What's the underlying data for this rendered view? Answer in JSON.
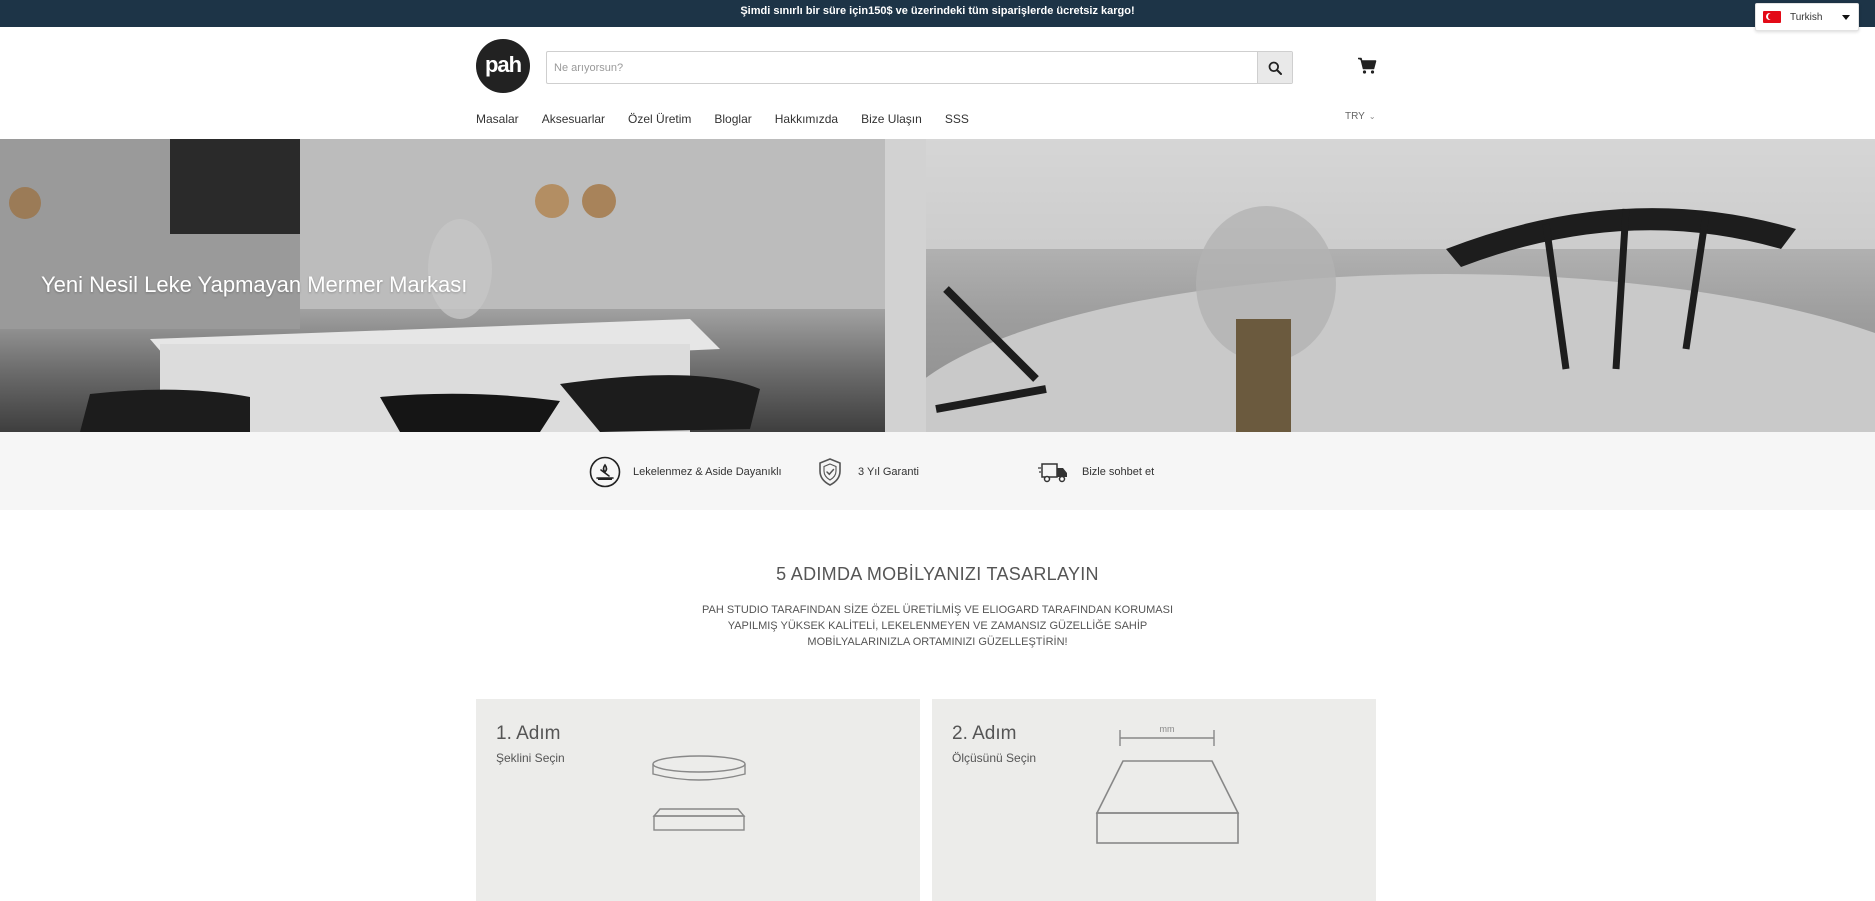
{
  "announcement": "Şimdi sınırlı bir süre için150$ ve üzerindeki tüm siparişlerde ücretsiz kargo!",
  "language_selector": {
    "label": "Turkish",
    "flag_icon": "turkey-flag-icon"
  },
  "logo": {
    "text": "pah"
  },
  "search": {
    "placeholder": "Ne arıyorsun?",
    "value": ""
  },
  "nav": {
    "items": [
      "Masalar",
      "Aksesuarlar",
      "Özel Üretim",
      "Bloglar",
      "Hakkımızda",
      "Bize Ulaşın",
      "SSS"
    ]
  },
  "currency": {
    "value": "TRY"
  },
  "hero": {
    "headline": "Yeni Nesil Leke Yapmayan Mermer Markası"
  },
  "features": [
    {
      "label": "Lekelenmez & Aside Dayanıklı",
      "icon": "stain-resistant-icon"
    },
    {
      "label": "3 Yıl Garanti",
      "icon": "shield-check-icon"
    },
    {
      "label": "Bizle sohbet et",
      "icon": "delivery-truck-icon"
    }
  ],
  "section": {
    "title": "5 ADIMDA MOBİLYANIZI TASARLAYIN",
    "description": "PAH STUDIO TARAFINDAN SİZE ÖZEL ÜRETİLMİŞ VE ELIOGARD TARAFINDAN KORUMASI YAPILMIŞ YÜKSEK KALİTELİ, LEKELENMEYEN VE ZAMANSIZ GÜZELLİĞE SAHİP MOBİLYALARINIZLA ORTAMINIZI GÜZELLEŞTİRİN!"
  },
  "steps": [
    {
      "number": "1. Adım",
      "label": "Şeklini Seçin"
    },
    {
      "number": "2. Adım",
      "label": "Ölçüsünü Seçin",
      "dimension_label": "mm"
    }
  ]
}
